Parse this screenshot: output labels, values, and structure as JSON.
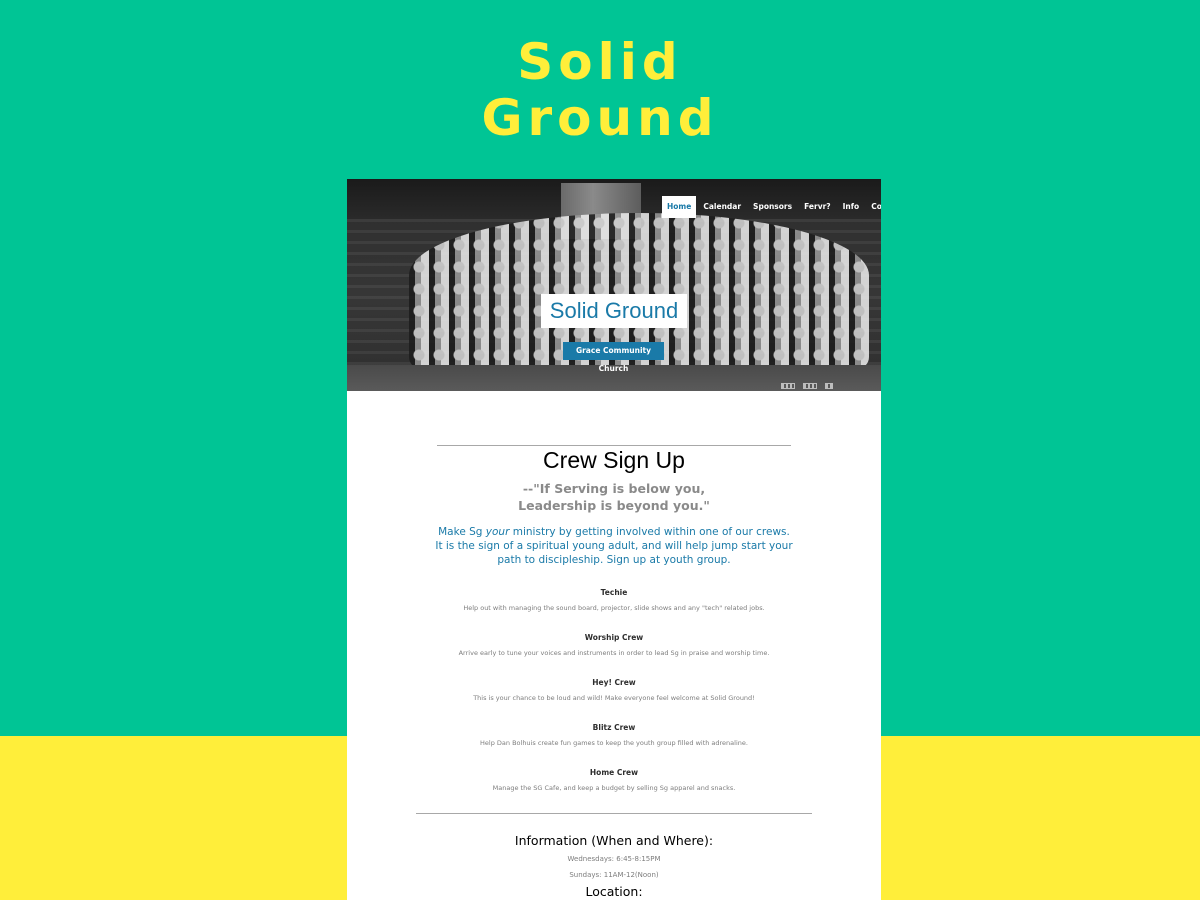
{
  "banner": {
    "title_line1": "Solid",
    "title_line2": "Ground"
  },
  "colors": {
    "background_top": "#00c595",
    "background_bottom": "#ffee3a",
    "title_yellow": "#ffee3a",
    "accent_blue": "#1a7aa8"
  },
  "nav": {
    "items": [
      {
        "label": "Home",
        "active": true
      },
      {
        "label": "Calendar",
        "active": false
      },
      {
        "label": "Sponsors",
        "active": false
      },
      {
        "label": "Fervr?",
        "active": false
      },
      {
        "label": "Info",
        "active": false
      },
      {
        "label": "Contact",
        "active": false
      }
    ]
  },
  "hero": {
    "site_title": "Solid Ground",
    "button_label": "Grace Community Church",
    "image": "group-photo"
  },
  "main": {
    "section_title": "Crew Sign Up",
    "quote_line1": "--\"If Serving is below you,",
    "quote_line2": "Leadership is beyond you.\"",
    "intro_before": "Make Sg ",
    "intro_emphasis": "your",
    "intro_after": " ministry by getting involved within one of our crews. It is the sign of a spiritual young adult, and will help jump start your path to discipleship. Sign up at youth group.",
    "crews": [
      {
        "name": "Techie",
        "description": "Help out with managing the sound board, projector, slide shows and any \"tech\" related jobs."
      },
      {
        "name": "Worship Crew",
        "description": "Arrive early to tune your voices and instruments in order to lead Sg in praise and worship time."
      },
      {
        "name": "Hey! Crew",
        "description": "This is your chance to be loud and wild! Make everyone feel welcome at Solid Ground!"
      },
      {
        "name": "Blitz Crew",
        "description": "Help Dan Bolhuis create fun games to keep the youth group filled with adrenaline."
      },
      {
        "name": "Home Crew",
        "description": "Manage the SG Cafe, and keep a budget by selling Sg apparel and snacks."
      }
    ]
  },
  "info": {
    "title": "Information (When and Where):",
    "wednesdays": "Wednesdays: 6:45-8:15PM",
    "sundays": "Sundays: 11AM-12(Noon)",
    "location_title": "Location:"
  }
}
